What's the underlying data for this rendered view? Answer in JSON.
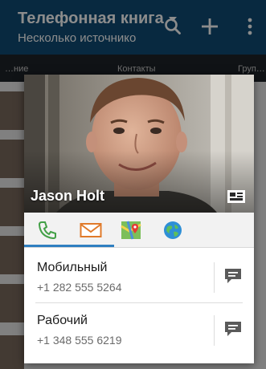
{
  "appbar": {
    "title": "Телефонная книга",
    "subtitle": "Несколько источнико"
  },
  "tabs": [
    "…ние",
    "Контакты",
    "Груп…"
  ],
  "underlying_name": "Jason Holt",
  "card": {
    "name": "Jason Holt",
    "icons": [
      "phone-icon",
      "mail-icon",
      "map-icon",
      "globe-icon"
    ],
    "entries": [
      {
        "label": "Мобильный",
        "number": "+1 282 555 5264"
      },
      {
        "label": "Рабочий",
        "number": "+1 348 555 6219"
      }
    ]
  },
  "colors": {
    "appbar": "#0f4c75",
    "accent": "#2f7fc1",
    "phone_green": "#43a047"
  }
}
